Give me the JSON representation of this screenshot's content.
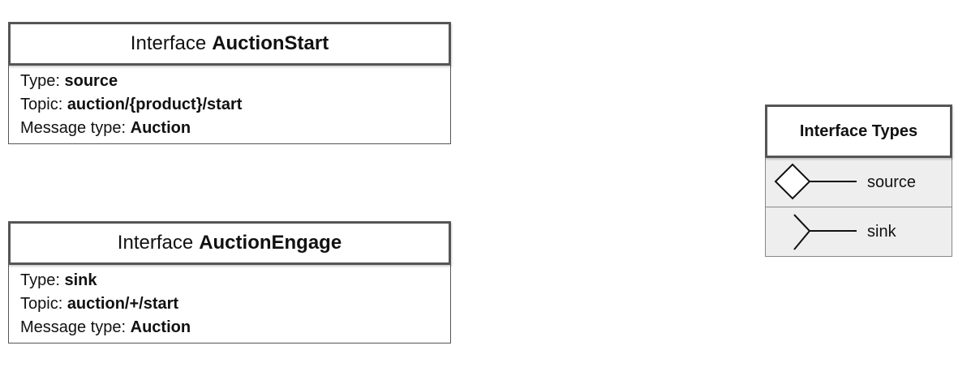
{
  "interfaces": [
    {
      "keyword": "Interface",
      "name": "AuctionStart",
      "type_label": "Type:",
      "type_value": "source",
      "topic_label": "Topic:",
      "topic_value": "auction/{product}/start",
      "message_label": "Message type:",
      "message_value": "Auction"
    },
    {
      "keyword": "Interface",
      "name": "AuctionEngage",
      "type_label": "Type:",
      "type_value": "sink",
      "topic_label": "Topic:",
      "topic_value": "auction/+/start",
      "message_label": "Message type:",
      "message_value": "Auction"
    }
  ],
  "legend": {
    "title": "Interface Types",
    "items": [
      {
        "icon": "source-diamond-icon",
        "label": "source"
      },
      {
        "icon": "sink-fork-icon",
        "label": "sink"
      }
    ]
  },
  "colors": {
    "border": "#555555",
    "legend_row_bg": "#eeeeee",
    "text": "#111111"
  }
}
